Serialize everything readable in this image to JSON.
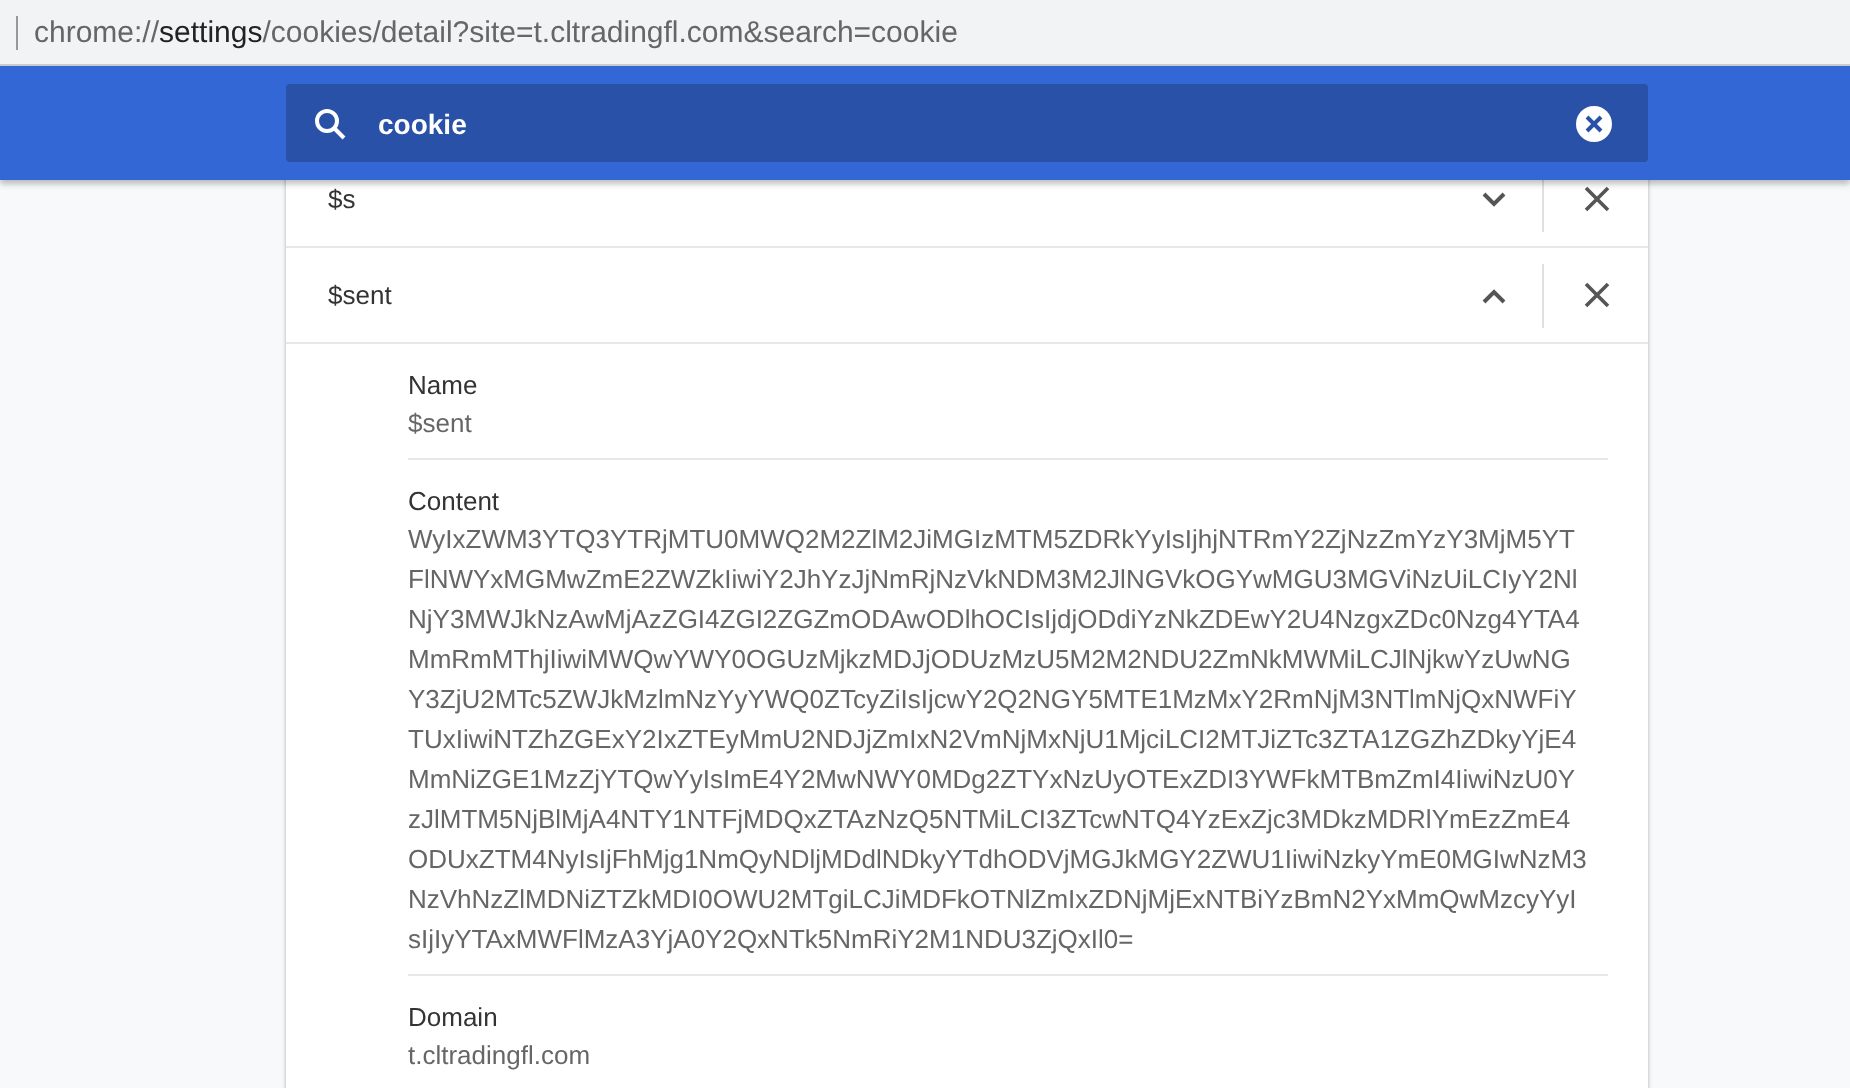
{
  "address_bar": {
    "url_prefix": "chrome://",
    "url_host": "settings",
    "url_path": "/cookies/detail?site=t.cltradingfl.com&search=cookie"
  },
  "search": {
    "value": "cookie"
  },
  "cookies": [
    {
      "name": "$s",
      "expanded": false
    },
    {
      "name": "$sent",
      "expanded": true,
      "details": [
        {
          "label": "Name",
          "value": "$sent"
        },
        {
          "label": "Content",
          "value": "WyIxZWM3YTQ3YTRjMTU0MWQ2M2ZlM2JiMGIzMTM5ZDRkYyIsIjhjNTRmY2ZjNzZmYzY3MjM5YTFlNWYxMGMwZmE2ZWZkIiwiY2JhYzJjNmRjNzVkNDM3M2JlNGVkOGYwMGU3MGViNzUiLCIyY2NlNjY3MWJkNzAwMjAzZGI4ZGI2ZGZmODAwODlhOCIsIjdjODdiYzNkZDEwY2U4NzgxZDc0Nzg4YTA4MmRmMThjIiwiMWQwYWY0OGUzMjkzMDJjODUzMzU5M2M2NDU2ZmNkMWMiLCJlNjkwYzUwNGY3ZjU2MTc5ZWJkMzlmNzYyYWQ0ZTcyZiIsIjcwY2Q2NGY5MTE1MzMxY2RmNjM3NTlmNjQxNWFiYTUxIiwiNTZhZGExY2IxZTEyMmU2NDJjZmIxN2VmNjMxNjU1MjciLCI2MTJiZTc3ZTA1ZGZhZDkyYjE4MmNiZGE1MzZjYTQwYyIsImE4Y2MwNWY0MDg2ZTYxNzUyOTExZDI3YWFkMTBmZmI4IiwiNzU0YzJlMTM5NjBlMjA4NTY1NTFjMDQxZTAzNzQ5NTMiLCI3ZTcwNTQ4YzExZjc3MDkzMDRlYmEzZmE4ODUxZTM4NyIsIjFhMjg1NmQyNDljMDdlNDkyYTdhODVjMGJkMGY2ZWU1IiwiNzkyYmE0MGIwNzM3NzVhNzZlMDNiZTZkMDI0OWU2MTgiLCJiMDFkOTNlZmIxZDNjMjExNTBiYzBmN2YxMmQwMzcyYyIsIjIyYTAxMWFlMzA3YjA0Y2QxNTk5NmRiY2M1NDU3ZjQxIl0="
        },
        {
          "label": "Domain",
          "value": "t.cltradingfl.com"
        }
      ]
    }
  ]
}
